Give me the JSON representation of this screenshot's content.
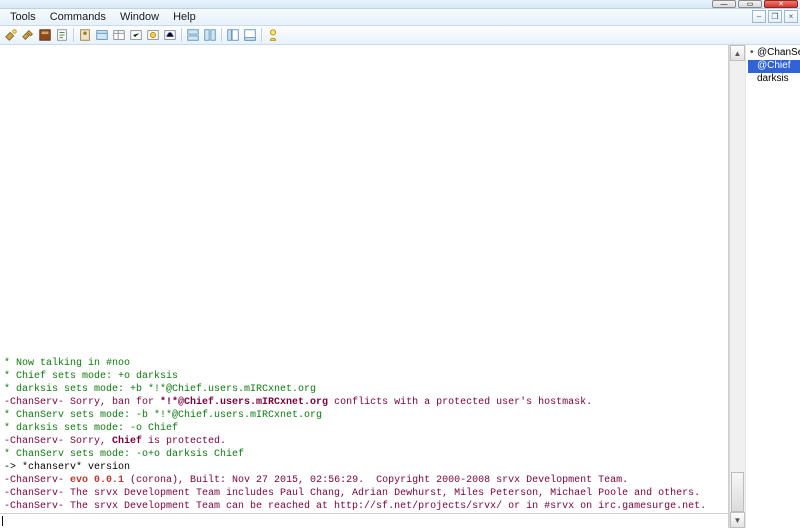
{
  "menu": {
    "items": [
      "Tools",
      "Commands",
      "Window",
      "Help"
    ]
  },
  "toolbar_icons": [
    "connect-icon",
    "disconnect-icon",
    "options-icon",
    "script-icon",
    "sep",
    "addressbook-icon",
    "links-icon",
    "channels-icon",
    "dcc-icon",
    "notify-icon",
    "urls-icon",
    "sep",
    "tile-h-icon",
    "tile-v-icon",
    "sep",
    "tree-icon",
    "switchbar-icon",
    "sep",
    "about-icon"
  ],
  "users": [
    {
      "prefix": "•",
      "nick": "@ChanServ",
      "selected": false
    },
    {
      "prefix": "",
      "nick": "@Chief",
      "selected": true
    },
    {
      "prefix": "",
      "nick": "darksis",
      "selected": false
    }
  ],
  "chat": [
    {
      "cls": "c-green",
      "text": "* Now talking in #noo"
    },
    {
      "cls": "c-green",
      "text": "* Chief sets mode: +o darksis"
    },
    {
      "cls": "c-green",
      "text": "* darksis sets mode: +b *!*@Chief.users.mIRCxnet.org"
    },
    {
      "cls": "c-maroon",
      "parts": [
        {
          "t": "-ChanServ- Sorry, ban for "
        },
        {
          "t": "*!*@Chief.users.mIRCxnet.org",
          "b": true
        },
        {
          "t": " conflicts with a protected user's hostmask."
        }
      ]
    },
    {
      "cls": "c-green",
      "text": "* ChanServ sets mode: -b *!*@Chief.users.mIRCxnet.org"
    },
    {
      "cls": "c-green",
      "text": "* darksis sets mode: -o Chief"
    },
    {
      "cls": "c-maroon",
      "parts": [
        {
          "t": "-ChanServ- Sorry, "
        },
        {
          "t": "Chief",
          "b": true
        },
        {
          "t": " is protected."
        }
      ]
    },
    {
      "cls": "c-green",
      "text": "* ChanServ sets mode: -o+o darksis Chief"
    },
    {
      "cls": "c-black",
      "text": "-> *chanserv* version"
    },
    {
      "cls": "c-maroon",
      "parts": [
        {
          "t": "-ChanServ- "
        },
        {
          "t": "evo 0.0.1",
          "b": true,
          "cls": "c-red"
        },
        {
          "t": " (corona), Built: Nov 27 2015, 02:56:29.  Copyright 2000-2008 srvx Development Team."
        }
      ]
    },
    {
      "cls": "c-maroon",
      "text": "-ChanServ- The srvx Development Team includes Paul Chang, Adrian Dewhurst, Miles Peterson, Michael Poole and others."
    },
    {
      "cls": "c-maroon",
      "text": "-ChanServ- The srvx Development Team can be reached at http://sf.net/projects/srvx/ or in #srvx on irc.gamesurge.net."
    }
  ]
}
